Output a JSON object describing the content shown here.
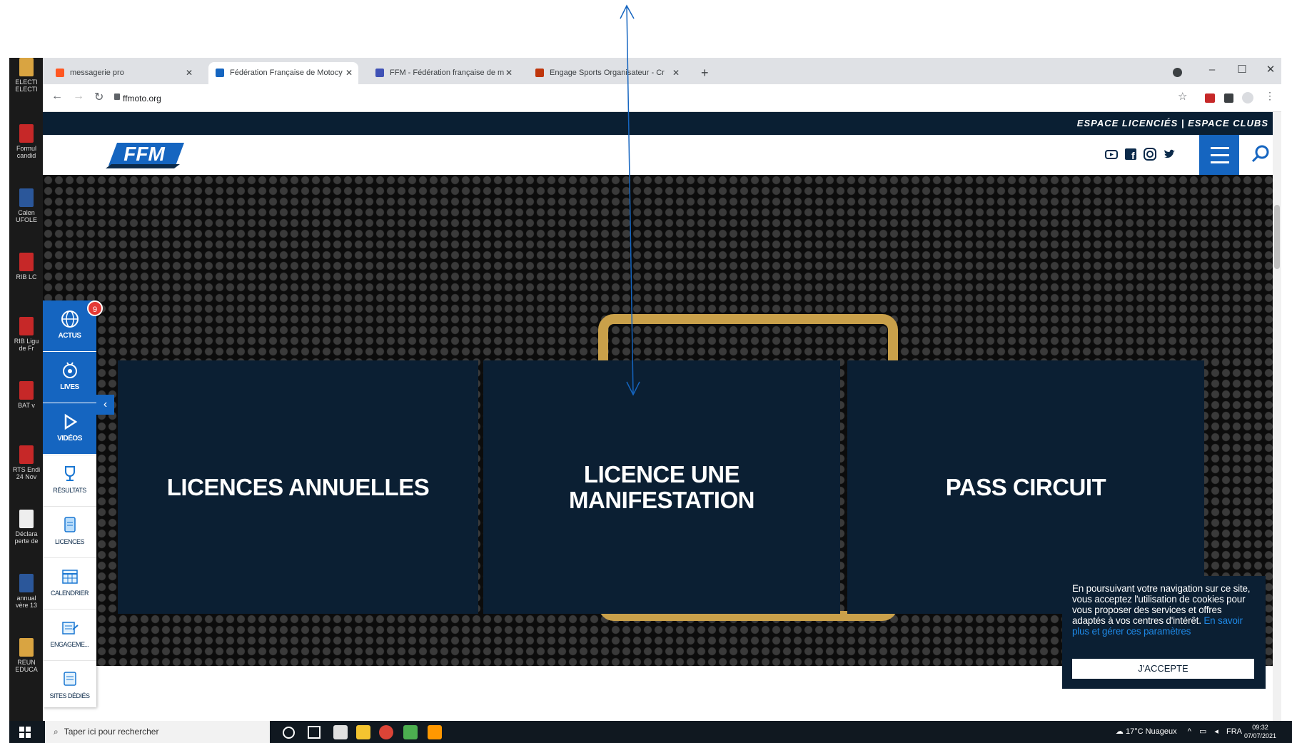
{
  "desktop": {
    "icons": [
      {
        "label": "ELECTI ELECTI",
        "icon": "folder-icon"
      },
      {
        "label": "Formul candid",
        "icon": "pdf-icon"
      },
      {
        "label": "Calen UFOLE",
        "icon": "word-icon"
      },
      {
        "label": "RIB LC",
        "icon": "pdf-icon"
      },
      {
        "label": "RIB Ligu de Fr",
        "icon": "pdf-icon"
      },
      {
        "label": "BAT v",
        "icon": "pdf-icon"
      },
      {
        "label": "RTS Endi 24 Nov",
        "icon": "pdf-icon"
      },
      {
        "label": "Déclara perte de",
        "icon": "document-icon"
      },
      {
        "label": "annual vère 13",
        "icon": "word-icon"
      },
      {
        "label": "REUN EDUCA",
        "icon": "folder-icon"
      }
    ]
  },
  "browser": {
    "tabs": [
      {
        "label": "messagerie pro",
        "fav_color": "#ff5722"
      },
      {
        "label": "Fédération Française de Motocy",
        "fav_color": "#1565c0"
      },
      {
        "label": "FFM - Fédération française de m",
        "fav_color": "#3f51b5"
      },
      {
        "label": "Engage Sports Organisateur - Cr",
        "fav_color": "#bf360c"
      }
    ],
    "new_tab": "+",
    "window_controls": {
      "minimize": "–",
      "maximize": "☐",
      "close": "✕"
    },
    "url": "ffmoto.org"
  },
  "site": {
    "top_links": "ESPACE LICENCIÉS | ESPACE CLUBS",
    "logo_text": "FFM",
    "social_icons": [
      "youtube-icon",
      "facebook-icon",
      "instagram-icon",
      "twitter-icon"
    ],
    "cards": [
      {
        "label": "LICENCES ANNUELLES"
      },
      {
        "label": "LICENCE UNE MANIFESTATION"
      },
      {
        "label": "PASS CIRCUIT"
      }
    ],
    "quick_menu": [
      {
        "label": "ACTUS",
        "icon": "globe-icon"
      },
      {
        "label": "LIVES",
        "icon": "live-icon"
      },
      {
        "label": "VIDÉOS",
        "icon": "play-icon"
      },
      {
        "label": "RÉSULTATS",
        "icon": "trophy-icon"
      },
      {
        "label": "LICENCES",
        "icon": "license-icon"
      },
      {
        "label": "CALENDRIER",
        "icon": "calendar-icon"
      },
      {
        "label": "ENGAGEME...",
        "icon": "engagement-icon"
      },
      {
        "label": "SITES DÉDIÉS",
        "icon": "sites-icon"
      }
    ],
    "actus_badge": "9",
    "collapse": "‹",
    "cookie": {
      "text": "En poursuivant votre navigation sur ce site, vous acceptez l'utilisation de cookies pour vous proposer des services et offres adaptés à vos centres d'intérêt.",
      "link": "En savoir plus et gérer ces paramètres",
      "button": "J'ACCEPTE"
    }
  },
  "taskbar": {
    "search_placeholder": "Taper ici pour rechercher",
    "weather": "17°C Nuageux",
    "lang": "FRA",
    "time": "09:32",
    "date": "07/07/2021"
  },
  "colors": {
    "navy": "#0b1f33",
    "blue": "#1565c0",
    "gold": "#c9a04a"
  }
}
